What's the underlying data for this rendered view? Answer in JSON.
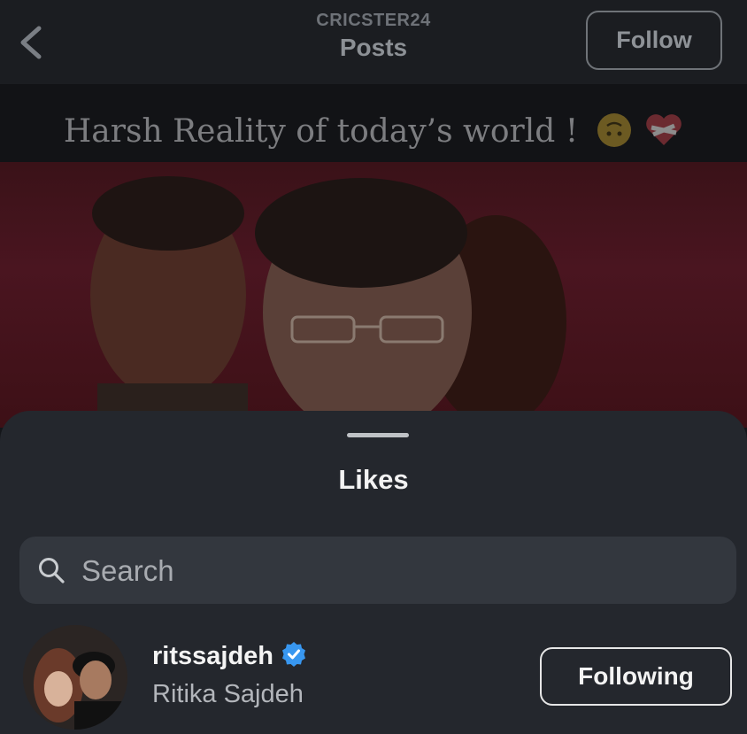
{
  "header": {
    "username": "CRICSTER24",
    "title": "Posts",
    "follow_label": "Follow"
  },
  "post": {
    "caption": "Harsh Reality of today’s world !",
    "caption_emojis": [
      "upside-down-face-icon",
      "mending-heart-icon"
    ]
  },
  "sheet": {
    "title": "Likes",
    "search": {
      "placeholder": "Search",
      "value": ""
    },
    "likes": [
      {
        "username": "ritssajdeh",
        "full_name": "Ritika Sajdeh",
        "verified": true,
        "button_label": "Following"
      }
    ]
  },
  "colors": {
    "sheet_bg": "#24272d",
    "verified_badge": "#3897f0",
    "photo_bg": "#4a1520"
  }
}
